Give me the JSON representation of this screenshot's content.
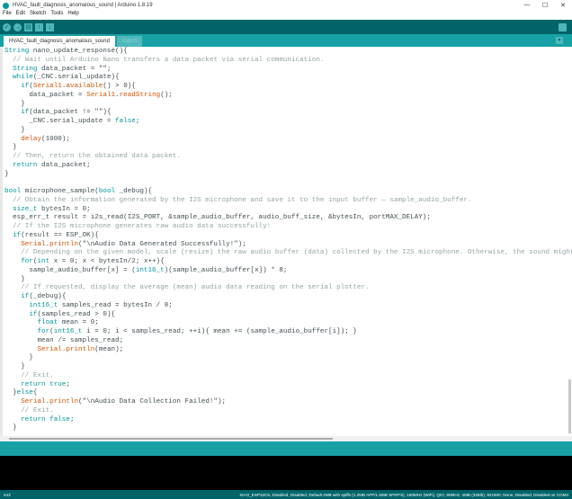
{
  "window": {
    "title": "HVAC_fault_diagnosis_anomalous_sound | Arduino 1.8.19",
    "minimize": "—",
    "maximize": "☐",
    "close": "✕"
  },
  "menu": [
    "File",
    "Edit",
    "Sketch",
    "Tools",
    "Help"
  ],
  "toolbar": {
    "verify": "✓",
    "upload": "→",
    "new": "▤",
    "open": "↑",
    "save": "↓"
  },
  "tabs": [
    {
      "label": "HVAC_fault_diagnosis_anomalous_sound"
    },
    {
      "label": "logo.h"
    }
  ],
  "tab_menu": "▾",
  "code": {
    "lines": [
      [
        [
          "String",
          "k"
        ],
        [
          " nano_update_response(){",
          ""
        ]
      ],
      [
        [
          "  // Wait until Arduino Nano transfers a data packet via serial communication.",
          "c"
        ]
      ],
      [
        [
          "  ",
          ""
        ],
        [
          "String",
          "k"
        ],
        [
          " data_packet = \"\";",
          ""
        ]
      ],
      [
        [
          "  ",
          ""
        ],
        [
          "while",
          "k"
        ],
        [
          "(_CNC.serial_update){",
          ""
        ]
      ],
      [
        [
          "    ",
          ""
        ],
        [
          "if",
          "k"
        ],
        [
          "(",
          ""
        ],
        [
          "Serial1",
          "f"
        ],
        [
          ".",
          ""
        ],
        [
          "available",
          "f"
        ],
        [
          "() > 0){",
          ""
        ]
      ],
      [
        [
          "      data_packet = ",
          ""
        ],
        [
          "Serial1",
          "f"
        ],
        [
          ".",
          ""
        ],
        [
          "readString",
          "f"
        ],
        [
          "();",
          ""
        ]
      ],
      [
        [
          "    }",
          ""
        ]
      ],
      [
        [
          "    ",
          ""
        ],
        [
          "if",
          "k"
        ],
        [
          "(data_packet != \"\"){",
          ""
        ]
      ],
      [
        [
          "      _CNC.serial_update = ",
          ""
        ],
        [
          "false",
          "k"
        ],
        [
          ";",
          ""
        ]
      ],
      [
        [
          "    }",
          ""
        ]
      ],
      [
        [
          "    ",
          ""
        ],
        [
          "delay",
          "f"
        ],
        [
          "(1000);",
          ""
        ]
      ],
      [
        [
          "  }",
          ""
        ]
      ],
      [
        [
          "  // Then, return the obtained data packet.",
          "c"
        ]
      ],
      [
        [
          "  ",
          ""
        ],
        [
          "return",
          "k"
        ],
        [
          " data_packet;",
          ""
        ]
      ],
      [
        [
          "}",
          ""
        ]
      ],
      [
        [
          "",
          ""
        ]
      ],
      [
        [
          "bool",
          "k"
        ],
        [
          " microphone_sample(",
          ""
        ],
        [
          "bool",
          "k"
        ],
        [
          " _debug){",
          ""
        ]
      ],
      [
        [
          "  // Obtain the information generated by the I2S microphone and save it to the input buffer — sample_audio_buffer.",
          "c"
        ]
      ],
      [
        [
          "  ",
          ""
        ],
        [
          "size_t",
          "k"
        ],
        [
          " bytesIn = 0;",
          ""
        ]
      ],
      [
        [
          "  esp_err_t result = i2s_read(I2S_PORT, &sample_audio_buffer, audio_buff_size, &bytesIn, portMAX_DELAY);",
          ""
        ]
      ],
      [
        [
          "  // If the I2S microphone generates raw audio data successfully:",
          "c"
        ]
      ],
      [
        [
          "  ",
          ""
        ],
        [
          "if",
          "k"
        ],
        [
          "(result == ESP_OK){",
          ""
        ]
      ],
      [
        [
          "    ",
          ""
        ],
        [
          "Serial",
          "f"
        ],
        [
          ".",
          ""
        ],
        [
          "println",
          "f"
        ],
        [
          "(\"\\nAudio Data Generated Successfully!\");",
          ""
        ]
      ],
      [
        [
          "    // Depending on the given model, scale (resize) the raw audio buffer (data) collected by the I2S microphone. Otherwise, the sound might be",
          "c"
        ]
      ],
      [
        [
          "    ",
          ""
        ],
        [
          "for",
          "k"
        ],
        [
          "(",
          ""
        ],
        [
          "int",
          "k"
        ],
        [
          " x = 0; x < bytesIn/2; x++){",
          ""
        ]
      ],
      [
        [
          "      sample_audio_buffer[x] = (",
          ""
        ],
        [
          "int16_t",
          "k"
        ],
        [
          ")(sample_audio_buffer[x]) * 8;",
          ""
        ]
      ],
      [
        [
          "    }",
          ""
        ]
      ],
      [
        [
          "    // If requested, display the average (mean) audio data reading on the serial plotter.",
          "c"
        ]
      ],
      [
        [
          "    ",
          ""
        ],
        [
          "if",
          "k"
        ],
        [
          "(_debug){",
          ""
        ]
      ],
      [
        [
          "      ",
          ""
        ],
        [
          "int16_t",
          "k"
        ],
        [
          " samples_read = bytesIn / 8;",
          ""
        ]
      ],
      [
        [
          "      ",
          ""
        ],
        [
          "if",
          "k"
        ],
        [
          "(samples_read > 0){",
          ""
        ]
      ],
      [
        [
          "        ",
          ""
        ],
        [
          "float",
          "k"
        ],
        [
          " mean = 0;",
          ""
        ]
      ],
      [
        [
          "        ",
          ""
        ],
        [
          "for",
          "k"
        ],
        [
          "(",
          ""
        ],
        [
          "int16_t",
          "k"
        ],
        [
          " i = 0; i < samples_read; ++i){ mean += (sample_audio_buffer[i]); }",
          ""
        ]
      ],
      [
        [
          "        mean /= samples_read;",
          ""
        ]
      ],
      [
        [
          "        ",
          ""
        ],
        [
          "Serial",
          "f"
        ],
        [
          ".",
          ""
        ],
        [
          "println",
          "f"
        ],
        [
          "(mean);",
          ""
        ]
      ],
      [
        [
          "      }",
          ""
        ]
      ],
      [
        [
          "    }",
          ""
        ]
      ],
      [
        [
          "    // Exit.",
          "c"
        ]
      ],
      [
        [
          "    ",
          ""
        ],
        [
          "return",
          "k"
        ],
        [
          " ",
          ""
        ],
        [
          "true",
          "k"
        ],
        [
          ";",
          ""
        ]
      ],
      [
        [
          "  }",
          ""
        ],
        [
          "else",
          "k"
        ],
        [
          "{",
          ""
        ]
      ],
      [
        [
          "    ",
          ""
        ],
        [
          "Serial",
          "f"
        ],
        [
          ".",
          ""
        ],
        [
          "println",
          "f"
        ],
        [
          "(\"\\nAudio Data Collection Failed!\");",
          ""
        ]
      ],
      [
        [
          "    // Exit.",
          "c"
        ]
      ],
      [
        [
          "    ",
          ""
        ],
        [
          "return",
          "k"
        ],
        [
          " ",
          ""
        ],
        [
          "false",
          "k"
        ],
        [
          ";",
          ""
        ]
      ],
      [
        [
          "  }",
          ""
        ]
      ]
    ]
  },
  "status": {
    "line_number": "443",
    "board": "XIAO_ESP32C6, Disabled, Disabled, Default 4MB with spiffs (1.2MB APP/1.5MB SPIFFS), 160MHz (WiFi), QIO, 80MHz, 4MB (32Mb), 921600, None, Disabled, Disabled on COM4"
  },
  "colors": {
    "toolbar": "#006468",
    "tabrow": "#17a1a5",
    "keyword": "#00979c",
    "function": "#d35400",
    "comment": "#95a5a6"
  }
}
